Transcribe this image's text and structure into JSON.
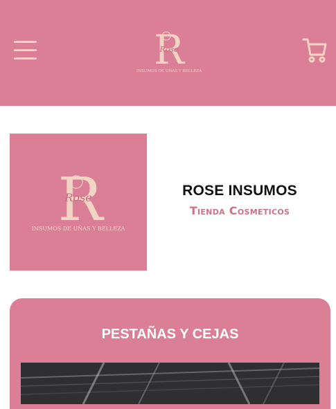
{
  "header": {
    "logo_letter": "R",
    "logo_script": "Rose",
    "logo_tagline": "INSUMOS DE UÑAS Y BELLEZA"
  },
  "profile": {
    "logo_letter": "R",
    "logo_script": "Rose",
    "logo_tagline": "INSUMOS DE UÑAS Y BELLEZA"
  },
  "store": {
    "name": "ROSE INSUMOS",
    "subtitle": "Tienda Cosmeticos"
  },
  "category": {
    "title": "PESTAÑAS Y CEJAS"
  },
  "colors": {
    "brand_pink": "#db7f97",
    "cream": "#f3d4c4",
    "subtitle_pink": "#cf7189"
  }
}
